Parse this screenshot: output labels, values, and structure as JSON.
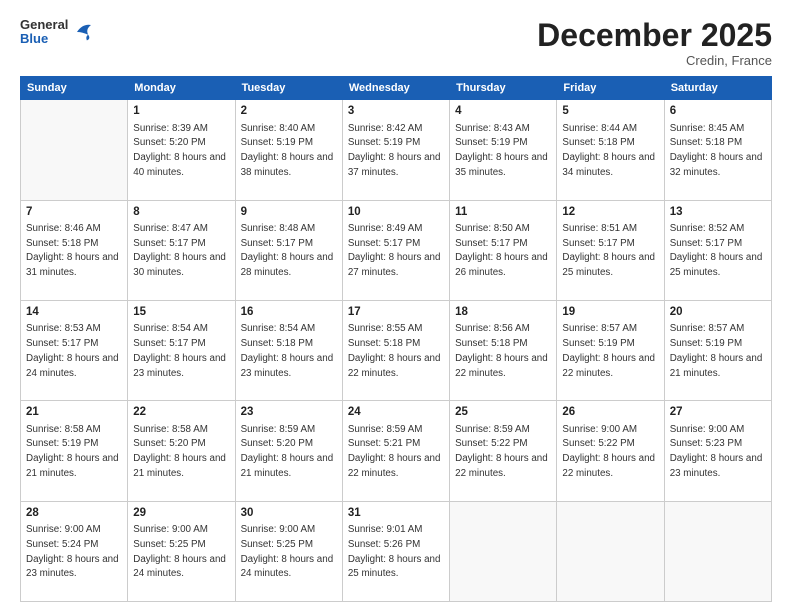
{
  "header": {
    "logo_general": "General",
    "logo_blue": "Blue",
    "month_title": "December 2025",
    "location": "Credin, France"
  },
  "weekdays": [
    "Sunday",
    "Monday",
    "Tuesday",
    "Wednesday",
    "Thursday",
    "Friday",
    "Saturday"
  ],
  "weeks": [
    [
      {
        "day": "",
        "sunrise": "",
        "sunset": "",
        "daylight": ""
      },
      {
        "day": "1",
        "sunrise": "Sunrise: 8:39 AM",
        "sunset": "Sunset: 5:20 PM",
        "daylight": "Daylight: 8 hours and 40 minutes."
      },
      {
        "day": "2",
        "sunrise": "Sunrise: 8:40 AM",
        "sunset": "Sunset: 5:19 PM",
        "daylight": "Daylight: 8 hours and 38 minutes."
      },
      {
        "day": "3",
        "sunrise": "Sunrise: 8:42 AM",
        "sunset": "Sunset: 5:19 PM",
        "daylight": "Daylight: 8 hours and 37 minutes."
      },
      {
        "day": "4",
        "sunrise": "Sunrise: 8:43 AM",
        "sunset": "Sunset: 5:19 PM",
        "daylight": "Daylight: 8 hours and 35 minutes."
      },
      {
        "day": "5",
        "sunrise": "Sunrise: 8:44 AM",
        "sunset": "Sunset: 5:18 PM",
        "daylight": "Daylight: 8 hours and 34 minutes."
      },
      {
        "day": "6",
        "sunrise": "Sunrise: 8:45 AM",
        "sunset": "Sunset: 5:18 PM",
        "daylight": "Daylight: 8 hours and 32 minutes."
      }
    ],
    [
      {
        "day": "7",
        "sunrise": "Sunrise: 8:46 AM",
        "sunset": "Sunset: 5:18 PM",
        "daylight": "Daylight: 8 hours and 31 minutes."
      },
      {
        "day": "8",
        "sunrise": "Sunrise: 8:47 AM",
        "sunset": "Sunset: 5:17 PM",
        "daylight": "Daylight: 8 hours and 30 minutes."
      },
      {
        "day": "9",
        "sunrise": "Sunrise: 8:48 AM",
        "sunset": "Sunset: 5:17 PM",
        "daylight": "Daylight: 8 hours and 28 minutes."
      },
      {
        "day": "10",
        "sunrise": "Sunrise: 8:49 AM",
        "sunset": "Sunset: 5:17 PM",
        "daylight": "Daylight: 8 hours and 27 minutes."
      },
      {
        "day": "11",
        "sunrise": "Sunrise: 8:50 AM",
        "sunset": "Sunset: 5:17 PM",
        "daylight": "Daylight: 8 hours and 26 minutes."
      },
      {
        "day": "12",
        "sunrise": "Sunrise: 8:51 AM",
        "sunset": "Sunset: 5:17 PM",
        "daylight": "Daylight: 8 hours and 25 minutes."
      },
      {
        "day": "13",
        "sunrise": "Sunrise: 8:52 AM",
        "sunset": "Sunset: 5:17 PM",
        "daylight": "Daylight: 8 hours and 25 minutes."
      }
    ],
    [
      {
        "day": "14",
        "sunrise": "Sunrise: 8:53 AM",
        "sunset": "Sunset: 5:17 PM",
        "daylight": "Daylight: 8 hours and 24 minutes."
      },
      {
        "day": "15",
        "sunrise": "Sunrise: 8:54 AM",
        "sunset": "Sunset: 5:17 PM",
        "daylight": "Daylight: 8 hours and 23 minutes."
      },
      {
        "day": "16",
        "sunrise": "Sunrise: 8:54 AM",
        "sunset": "Sunset: 5:18 PM",
        "daylight": "Daylight: 8 hours and 23 minutes."
      },
      {
        "day": "17",
        "sunrise": "Sunrise: 8:55 AM",
        "sunset": "Sunset: 5:18 PM",
        "daylight": "Daylight: 8 hours and 22 minutes."
      },
      {
        "day": "18",
        "sunrise": "Sunrise: 8:56 AM",
        "sunset": "Sunset: 5:18 PM",
        "daylight": "Daylight: 8 hours and 22 minutes."
      },
      {
        "day": "19",
        "sunrise": "Sunrise: 8:57 AM",
        "sunset": "Sunset: 5:19 PM",
        "daylight": "Daylight: 8 hours and 22 minutes."
      },
      {
        "day": "20",
        "sunrise": "Sunrise: 8:57 AM",
        "sunset": "Sunset: 5:19 PM",
        "daylight": "Daylight: 8 hours and 21 minutes."
      }
    ],
    [
      {
        "day": "21",
        "sunrise": "Sunrise: 8:58 AM",
        "sunset": "Sunset: 5:19 PM",
        "daylight": "Daylight: 8 hours and 21 minutes."
      },
      {
        "day": "22",
        "sunrise": "Sunrise: 8:58 AM",
        "sunset": "Sunset: 5:20 PM",
        "daylight": "Daylight: 8 hours and 21 minutes."
      },
      {
        "day": "23",
        "sunrise": "Sunrise: 8:59 AM",
        "sunset": "Sunset: 5:20 PM",
        "daylight": "Daylight: 8 hours and 21 minutes."
      },
      {
        "day": "24",
        "sunrise": "Sunrise: 8:59 AM",
        "sunset": "Sunset: 5:21 PM",
        "daylight": "Daylight: 8 hours and 22 minutes."
      },
      {
        "day": "25",
        "sunrise": "Sunrise: 8:59 AM",
        "sunset": "Sunset: 5:22 PM",
        "daylight": "Daylight: 8 hours and 22 minutes."
      },
      {
        "day": "26",
        "sunrise": "Sunrise: 9:00 AM",
        "sunset": "Sunset: 5:22 PM",
        "daylight": "Daylight: 8 hours and 22 minutes."
      },
      {
        "day": "27",
        "sunrise": "Sunrise: 9:00 AM",
        "sunset": "Sunset: 5:23 PM",
        "daylight": "Daylight: 8 hours and 23 minutes."
      }
    ],
    [
      {
        "day": "28",
        "sunrise": "Sunrise: 9:00 AM",
        "sunset": "Sunset: 5:24 PM",
        "daylight": "Daylight: 8 hours and 23 minutes."
      },
      {
        "day": "29",
        "sunrise": "Sunrise: 9:00 AM",
        "sunset": "Sunset: 5:25 PM",
        "daylight": "Daylight: 8 hours and 24 minutes."
      },
      {
        "day": "30",
        "sunrise": "Sunrise: 9:00 AM",
        "sunset": "Sunset: 5:25 PM",
        "daylight": "Daylight: 8 hours and 24 minutes."
      },
      {
        "day": "31",
        "sunrise": "Sunrise: 9:01 AM",
        "sunset": "Sunset: 5:26 PM",
        "daylight": "Daylight: 8 hours and 25 minutes."
      },
      {
        "day": "",
        "sunrise": "",
        "sunset": "",
        "daylight": ""
      },
      {
        "day": "",
        "sunrise": "",
        "sunset": "",
        "daylight": ""
      },
      {
        "day": "",
        "sunrise": "",
        "sunset": "",
        "daylight": ""
      }
    ]
  ]
}
